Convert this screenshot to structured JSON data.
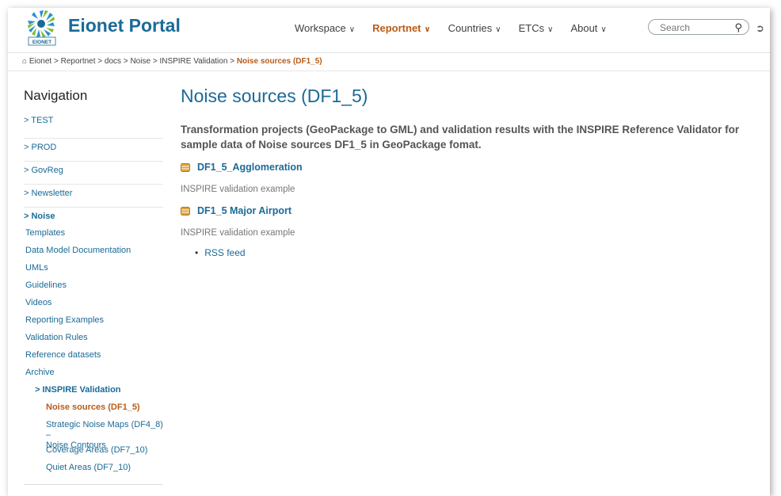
{
  "header": {
    "brand": "Eionet Portal",
    "logo_text": "EIONET",
    "nav": [
      {
        "label": "Workspace",
        "active": false
      },
      {
        "label": "Reportnet",
        "active": true
      },
      {
        "label": "Countries",
        "active": false
      },
      {
        "label": "ETCs",
        "active": false
      },
      {
        "label": "About",
        "active": false
      }
    ],
    "search_placeholder": "Search",
    "accent": "#b85c17",
    "brand_color": "#1b6a97"
  },
  "breadcrumb": {
    "items": [
      "Eionet",
      "Reportnet",
      "docs",
      "Noise",
      "INSPIRE Validation"
    ],
    "separator": ">",
    "current": "Noise sources (DF1_5)"
  },
  "sidebar": {
    "title": "Navigation",
    "top_items": [
      "TEST",
      "PROD",
      "GovReg",
      "Newsletter"
    ],
    "open_item": "Noise",
    "sub_items": [
      "Templates",
      "Data Model Documentation",
      "UMLs",
      "Guidelines",
      "Videos",
      "Reporting Examples",
      "Validation Rules",
      "Reference datasets",
      "Archive"
    ],
    "subsection": "INSPIRE Validation",
    "subsection_items": [
      "Noise sources (DF1_5)",
      "Strategic Noise Maps (DF4_8) –\nNoise Contours",
      "Coverage Areas (DF7_10)",
      "Quiet Areas (DF7_10)"
    ]
  },
  "main": {
    "title": "Noise sources (DF1_5)",
    "lead": "Transformation projects (GeoPackage to GML) and validation results with the INSPIRE Reference Validator for sample data of Noise sources DF1_5 in GeoPackage fomat.",
    "resources": [
      {
        "label": "DF1_5_Agglomeration",
        "desc": "INSPIRE validation example"
      },
      {
        "label": "DF1_5 Major Airport",
        "desc": "INSPIRE validation example"
      }
    ],
    "rss": "RSS feed"
  }
}
